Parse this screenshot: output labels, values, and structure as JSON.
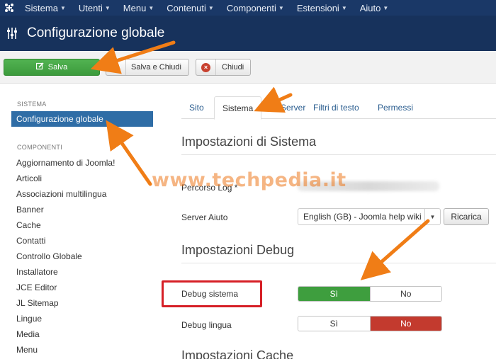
{
  "topnav": {
    "items": [
      {
        "label": "Sistema"
      },
      {
        "label": "Utenti"
      },
      {
        "label": "Menu"
      },
      {
        "label": "Contenuti"
      },
      {
        "label": "Componenti"
      },
      {
        "label": "Estensioni"
      },
      {
        "label": "Aiuto"
      }
    ]
  },
  "header": {
    "title": "Configurazione globale"
  },
  "toolbar": {
    "save_label": "Salva",
    "save_close_label": "Salva e Chiudi",
    "close_label": "Chiudi"
  },
  "sidebar": {
    "section_system": "SISTEMA",
    "active_item": "Configurazione globale",
    "section_components": "COMPONENTI",
    "items": [
      "Aggiornamento di Joomla!",
      "Articoli",
      "Associazioni multilingua",
      "Banner",
      "Cache",
      "Contatti",
      "Controllo Globale",
      "Installatore",
      "JCE Editor",
      "JL Sitemap",
      "Lingue",
      "Media",
      "Menu"
    ]
  },
  "tabs": [
    {
      "label": "Sito"
    },
    {
      "label": "Sistema"
    },
    {
      "label": "Server"
    },
    {
      "label": "Filtri di testo"
    },
    {
      "label": "Permessi"
    }
  ],
  "system_settings": {
    "heading": "Impostazioni di Sistema",
    "log_path_label": "Percorso Log *",
    "help_server_label": "Server Aiuto",
    "help_server_value": "English (GB) - Joomla help wiki",
    "reload_label": "Ricarica"
  },
  "debug_settings": {
    "heading": "Impostazioni Debug",
    "debug_system_label": "Debug sistema",
    "debug_system_yes": "Sì",
    "debug_system_no": "No",
    "debug_language_label": "Debug lingua",
    "debug_language_yes": "Sì",
    "debug_language_no": "No"
  },
  "cache_settings": {
    "heading": "Impostazioni Cache"
  },
  "watermark": "www.techpedia.it",
  "colors": {
    "nav_bg": "#1a3867",
    "title_bg": "#17325c",
    "save_green": "#46a546",
    "active_blue": "#2f6da6",
    "toggle_green": "#3e9e3e",
    "toggle_red": "#c33a2e",
    "arrow_orange": "#f07d16",
    "highlight_red": "#d61f26"
  }
}
